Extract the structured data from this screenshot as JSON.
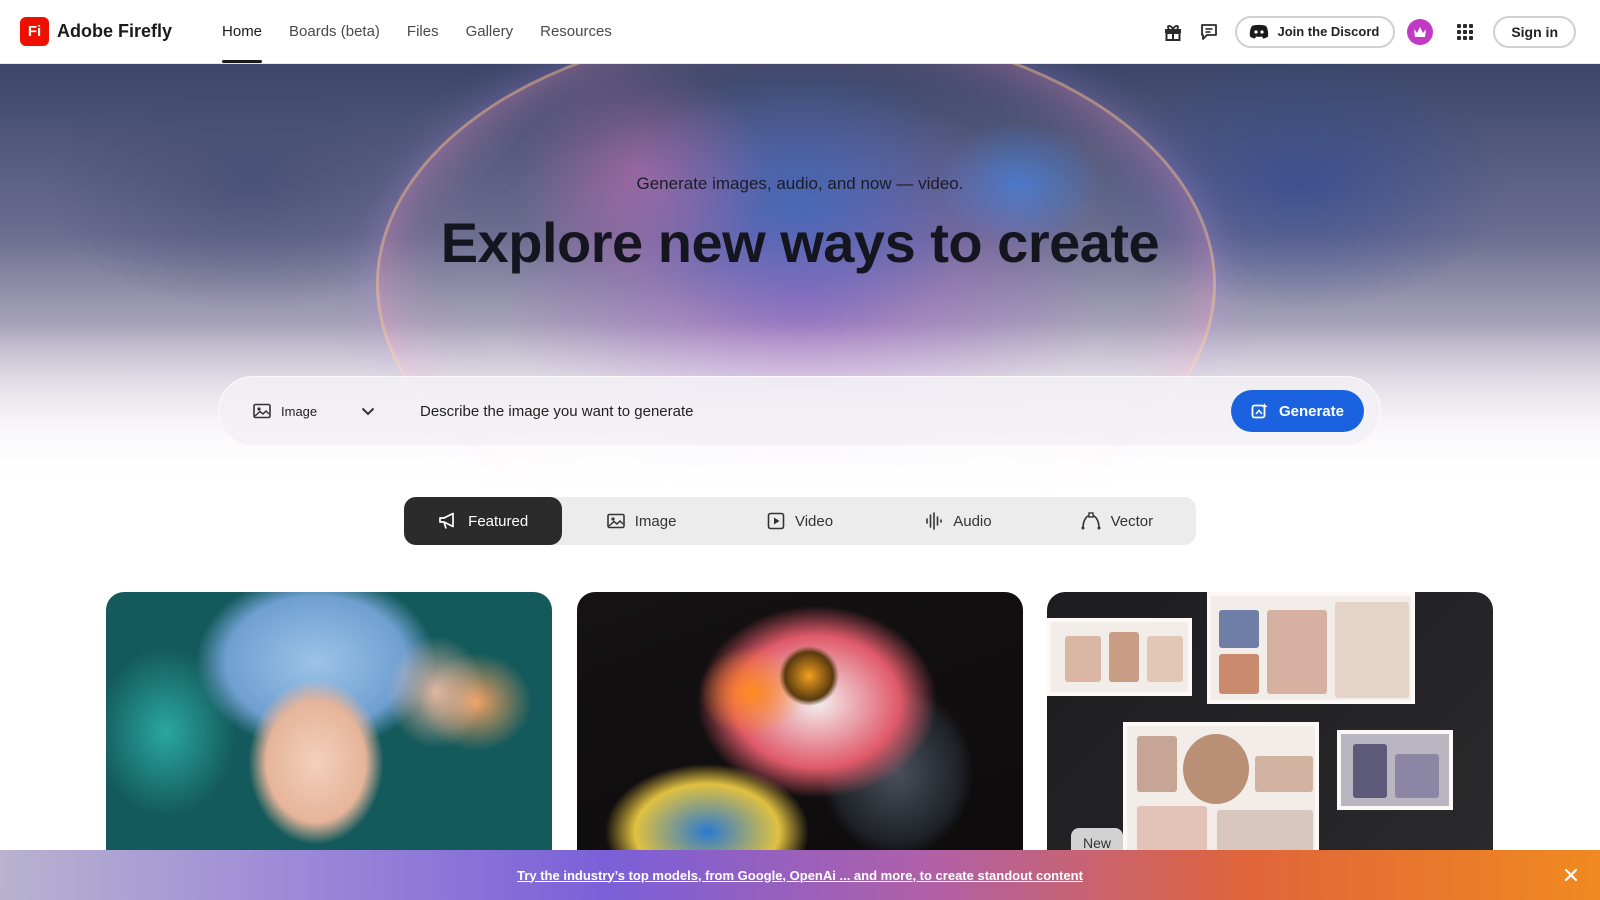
{
  "brand": {
    "logo_text": "Fi",
    "name": "Adobe Firefly",
    "color": "#eb1000"
  },
  "nav": [
    {
      "label": "Home",
      "active": true
    },
    {
      "label": "Boards (beta)",
      "active": false
    },
    {
      "label": "Files",
      "active": false
    },
    {
      "label": "Gallery",
      "active": false
    },
    {
      "label": "Resources",
      "active": false
    }
  ],
  "header_actions": {
    "gift_icon": "gift-icon",
    "feedback_icon": "chat-bubble-icon",
    "discord_label": "Join the Discord",
    "apps_icon": "app-grid-icon",
    "signin_label": "Sign in"
  },
  "hero": {
    "subtitle": "Generate images, audio, and now — video.",
    "title": "Explore new ways to create",
    "prompt": {
      "type_label": "Image",
      "placeholder": "Describe the image you want to generate",
      "generate_label": "Generate",
      "accent_color": "#1b62e0"
    }
  },
  "tabs": [
    {
      "label": "Featured",
      "icon": "megaphone-icon",
      "active": true
    },
    {
      "label": "Image",
      "icon": "image-icon",
      "active": false
    },
    {
      "label": "Video",
      "icon": "video-icon",
      "active": false
    },
    {
      "label": "Audio",
      "icon": "audio-waveform-icon",
      "active": false
    },
    {
      "label": "Vector",
      "icon": "vector-pen-icon",
      "active": false
    }
  ],
  "cards": [
    {
      "subject": "anime portrait with blue hair and floral headdress"
    },
    {
      "subject": "colorful parrot close-up"
    },
    {
      "subject": "product moodboard collage",
      "badge": "New"
    }
  ],
  "banner": {
    "text": "Try the industry’s top models, from Google, OpenAi ... and more, to create standout content"
  }
}
